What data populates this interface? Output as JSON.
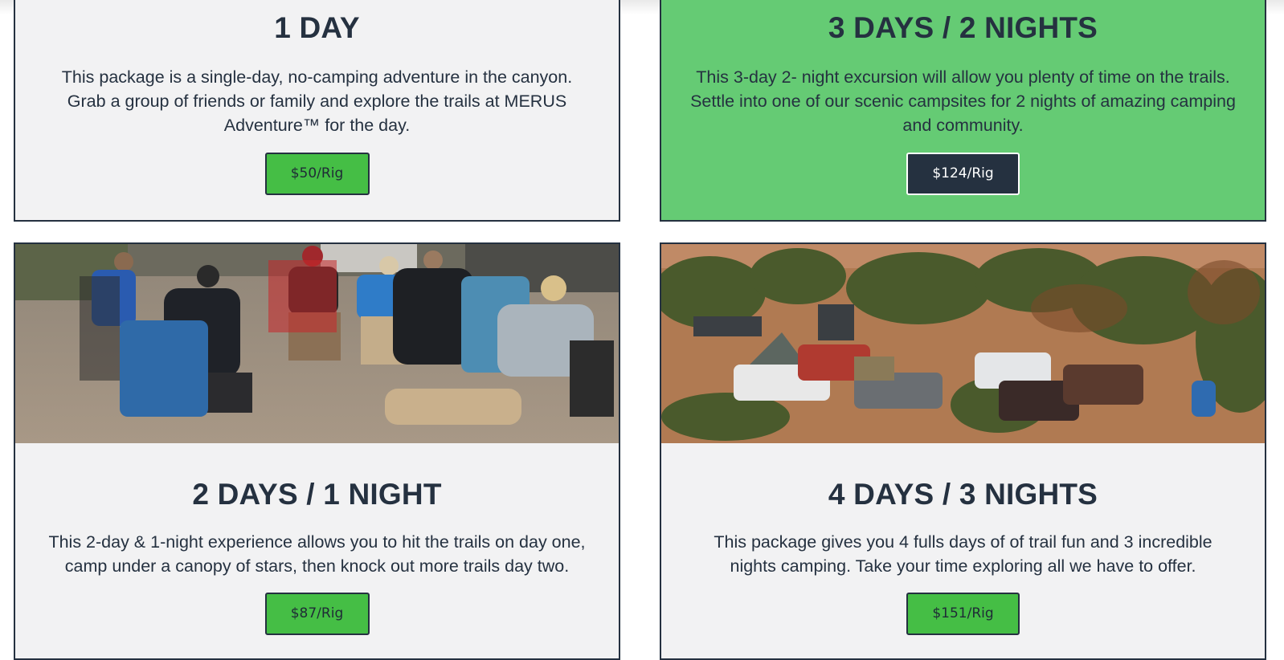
{
  "packages": [
    {
      "title": "1 DAY",
      "description": "This package is a single-day, no-camping adventure in the canyon. Grab a group of friends or family and explore the trails at MERUS Adventure™ for the day.",
      "price_label": "$50/Rig"
    },
    {
      "title": "3 DAYS / 2 NIGHTS",
      "description": "This 3-day 2- night excursion will allow you plenty of time on the trails. Settle into one of our scenic campsites for 2 nights of amazing camping and community.",
      "price_label": "$124/Rig"
    },
    {
      "title": "2 DAYS / 1 NIGHT",
      "description": "This 2-day & 1-night experience allows you to hit the trails on day one, camp under a canopy of stars, then knock out more trails day two.",
      "price_label": "$87/Rig"
    },
    {
      "title": "4 DAYS / 3 NIGHTS",
      "description": "This package gives you 4 fulls days of of trail fun and 3 incredible nights camping. Take your time exploring all we have to offer.",
      "price_label": "$151/Rig"
    }
  ],
  "colors": {
    "dark": "#253140",
    "card_gray": "#f2f2f3",
    "card_green": "#65cb74",
    "button_green": "#45be45"
  }
}
